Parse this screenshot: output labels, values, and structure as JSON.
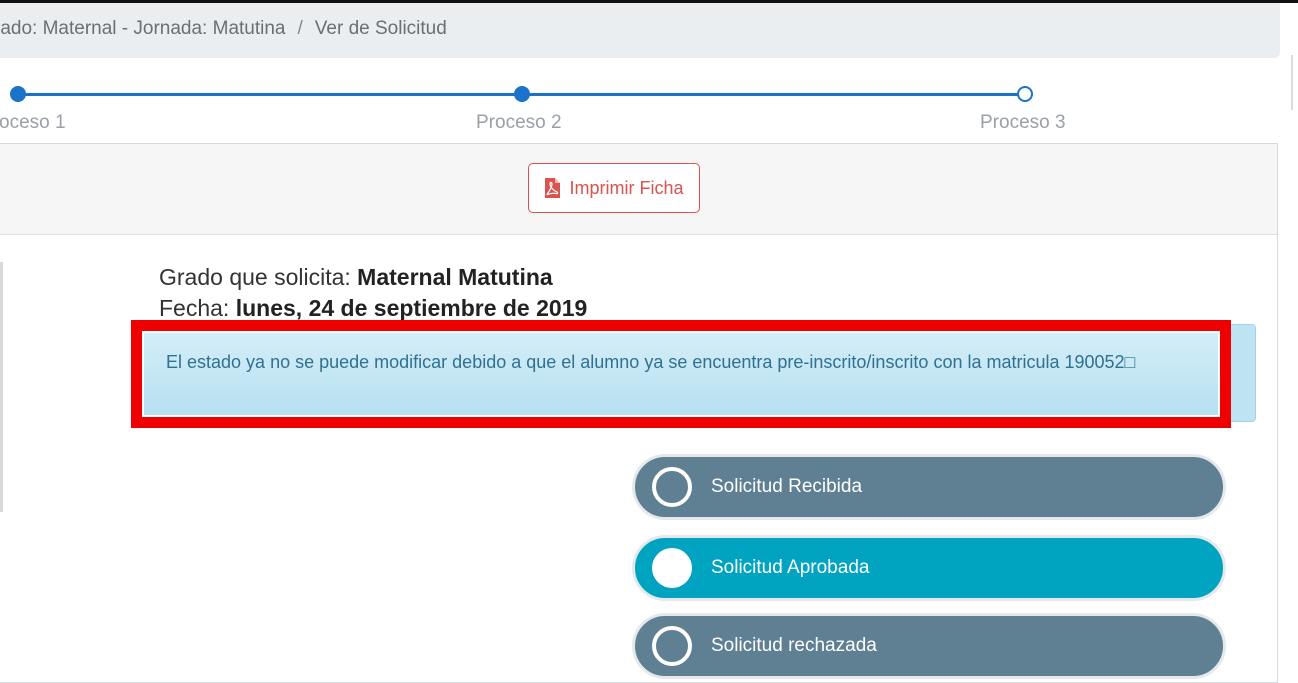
{
  "breadcrumb": {
    "path": "rado: Maternal - Jornada: Matutina",
    "separator": "/",
    "current": "Ver de Solicitud"
  },
  "stepper": {
    "steps": [
      {
        "label": "oceso 1",
        "state": "completed"
      },
      {
        "label": "Proceso 2",
        "state": "completed"
      },
      {
        "label": "Proceso 3",
        "state": "pending"
      }
    ]
  },
  "toolbar": {
    "print_label": "Imprimir Ficha",
    "print_icon": "pdf-icon"
  },
  "info": {
    "grade_label": "Grado que solicita:",
    "grade_value": "Maternal Matutina",
    "date_label": "Fecha:",
    "date_value": "lunes, 24 de septiembre de 2019"
  },
  "alert": {
    "message": "El estado ya no se puede modificar debido a que el alumno ya se encuentra pre-inscrito/inscrito con la matricula 190052□"
  },
  "statuses": [
    {
      "label": "Solicitud Recibida",
      "selected": false
    },
    {
      "label": "Solicitud Aprobada",
      "selected": true
    },
    {
      "label": "Solicitud rechazada",
      "selected": false
    }
  ],
  "colors": {
    "accent": "#1a73c9",
    "status_default": "#5f7f92",
    "status_selected": "#00a3c0",
    "highlight": "#ee0000",
    "pdf": "#d9534f"
  }
}
